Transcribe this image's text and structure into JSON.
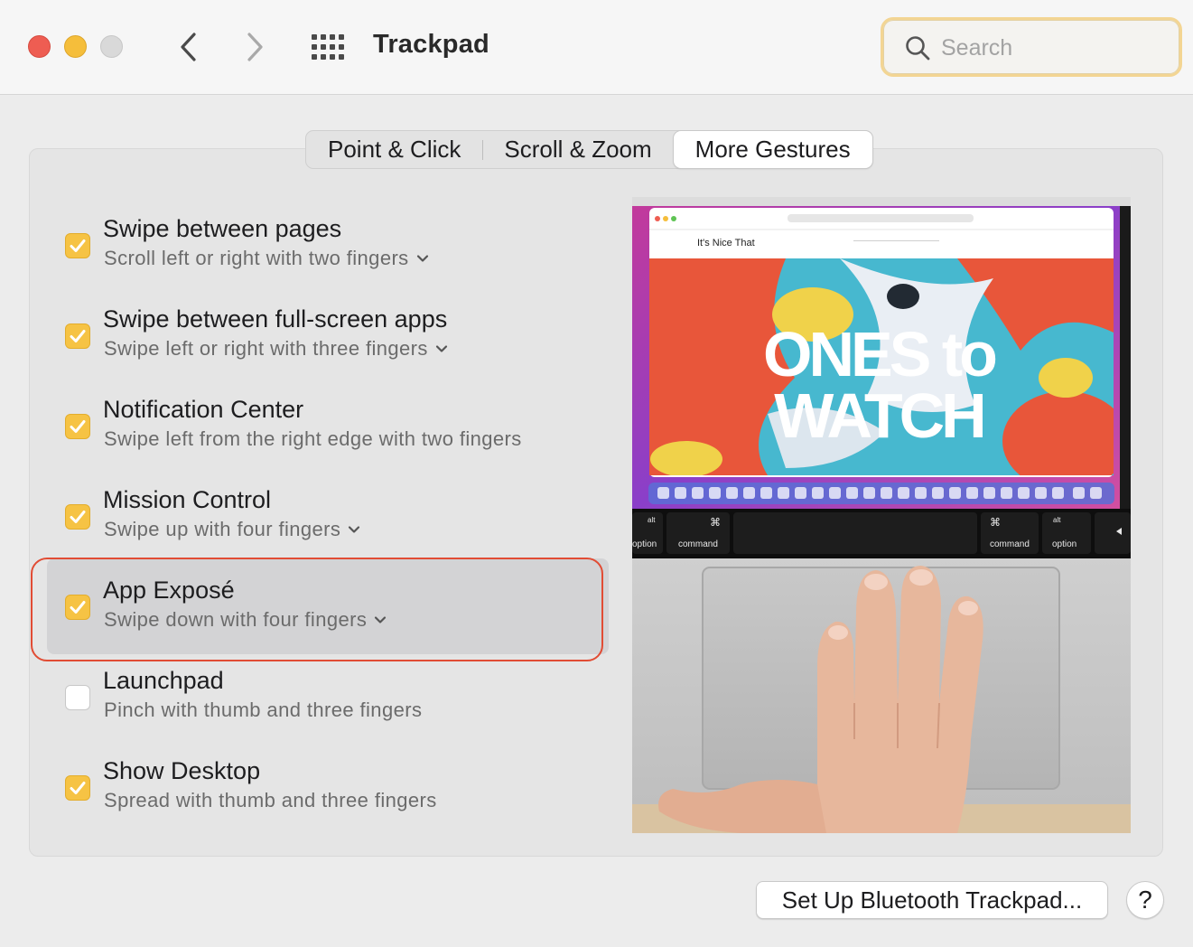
{
  "window": {
    "title": "Trackpad",
    "traffic_lights": [
      "close",
      "minimize",
      "zoom-disabled"
    ]
  },
  "search": {
    "placeholder": "Search"
  },
  "tabs": [
    {
      "label": "Point & Click",
      "active": false
    },
    {
      "label": "Scroll & Zoom",
      "active": false
    },
    {
      "label": "More Gestures",
      "active": true
    }
  ],
  "gestures": [
    {
      "title": "Swipe between pages",
      "subtitle": "Scroll left or right with two fingers",
      "checked": true,
      "has_menu": true
    },
    {
      "title": "Swipe between full-screen apps",
      "subtitle": "Swipe left or right with three fingers",
      "checked": true,
      "has_menu": true
    },
    {
      "title": "Notification Center",
      "subtitle": "Swipe left from the right edge with two fingers",
      "checked": true,
      "has_menu": false
    },
    {
      "title": "Mission Control",
      "subtitle": "Swipe up with four fingers",
      "checked": true,
      "has_menu": true
    },
    {
      "title": "App Exposé",
      "subtitle": "Swipe down with four fingers",
      "checked": true,
      "has_menu": true,
      "selected": true
    },
    {
      "title": "Launchpad",
      "subtitle": "Pinch with thumb and three fingers",
      "checked": false,
      "has_menu": false
    },
    {
      "title": "Show Desktop",
      "subtitle": "Spread with thumb and three fingers",
      "checked": true,
      "has_menu": false
    }
  ],
  "preview": {
    "site_name": "It's Nice That",
    "headline_line1": "ONES to",
    "headline_line2": "WATCH",
    "keys": {
      "left_alt": "alt",
      "left_option": "option",
      "left_cmd_symbol": "⌘",
      "left_command": "command",
      "right_cmd_symbol": "⌘",
      "right_command": "command",
      "right_alt": "alt",
      "right_option": "option"
    }
  },
  "footer": {
    "bluetooth_button": "Set Up Bluetooth Trackpad...",
    "help_button": "?"
  },
  "colors": {
    "checkbox_accent": "#f6c344",
    "highlight_border": "#e14c34",
    "search_focus_ring": "#f3d593"
  }
}
